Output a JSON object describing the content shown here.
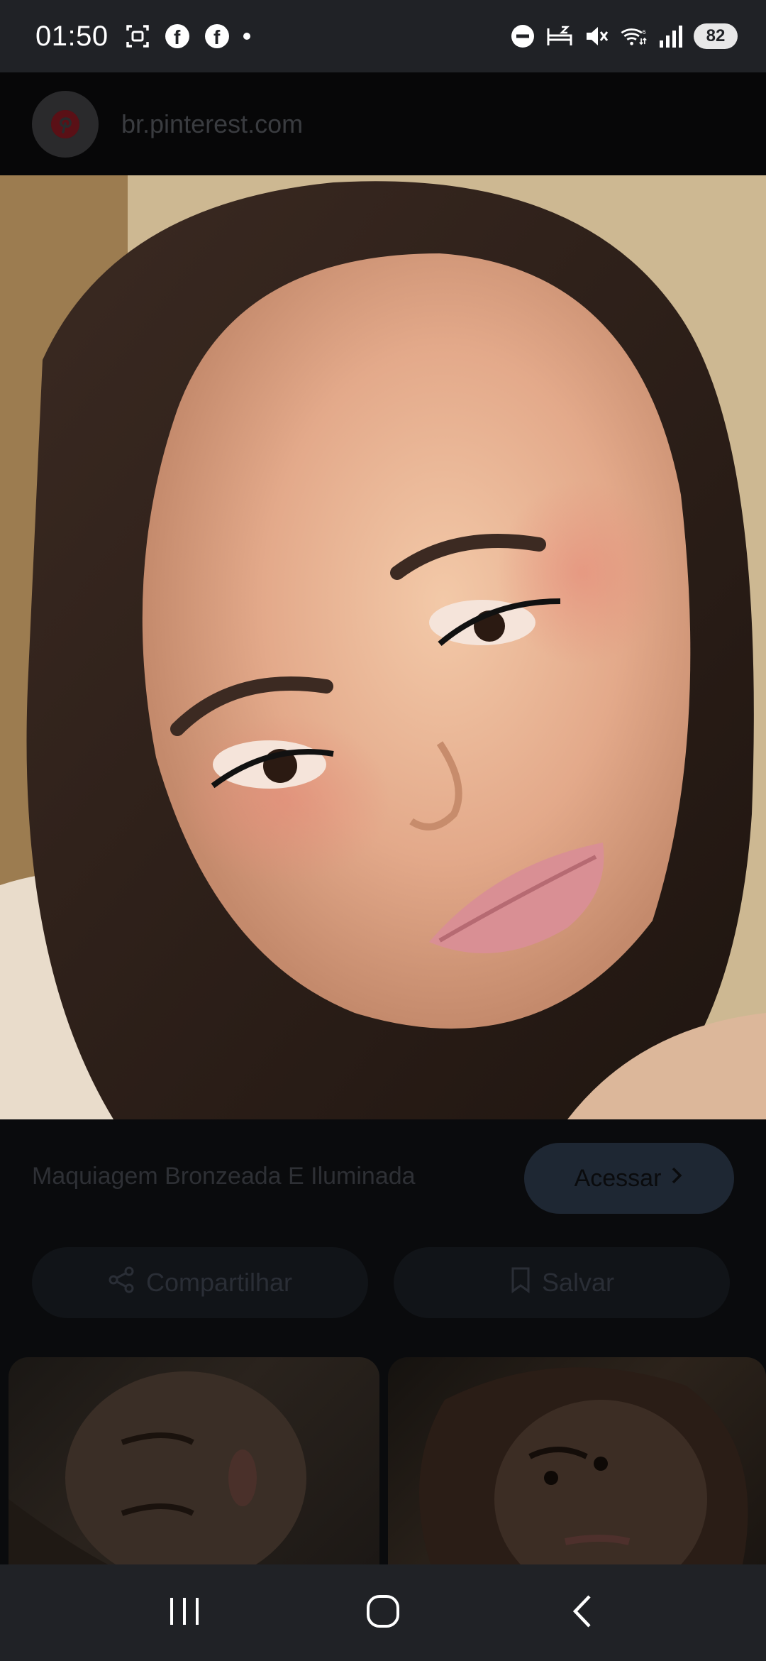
{
  "status_bar": {
    "time": "01:50",
    "left_icons": [
      "screenshot-icon",
      "facebook-icon",
      "facebook-icon",
      "notification-dot"
    ],
    "right_icons": [
      "do-not-disturb-icon",
      "sleep-mode-icon",
      "mute-icon",
      "wifi-6-icon",
      "signal-icon"
    ],
    "battery": "82"
  },
  "url_bar": {
    "logo_letter": "p",
    "url": "br.pinterest.com"
  },
  "hero_image": {
    "description_icon": "photo"
  },
  "pin": {
    "title": "Maquiagem Bronzeada E Iluminada",
    "access_label": "Acessar"
  },
  "actions": {
    "share_label": "Compartilhar",
    "save_label": "Salvar"
  },
  "nav_bar": {
    "buttons": [
      "recents-icon",
      "home-icon",
      "back-icon"
    ]
  },
  "colors": {
    "status_bg": "#202226",
    "overlay_bg": "#0a0b0d",
    "access_bg": "#1e2733"
  }
}
